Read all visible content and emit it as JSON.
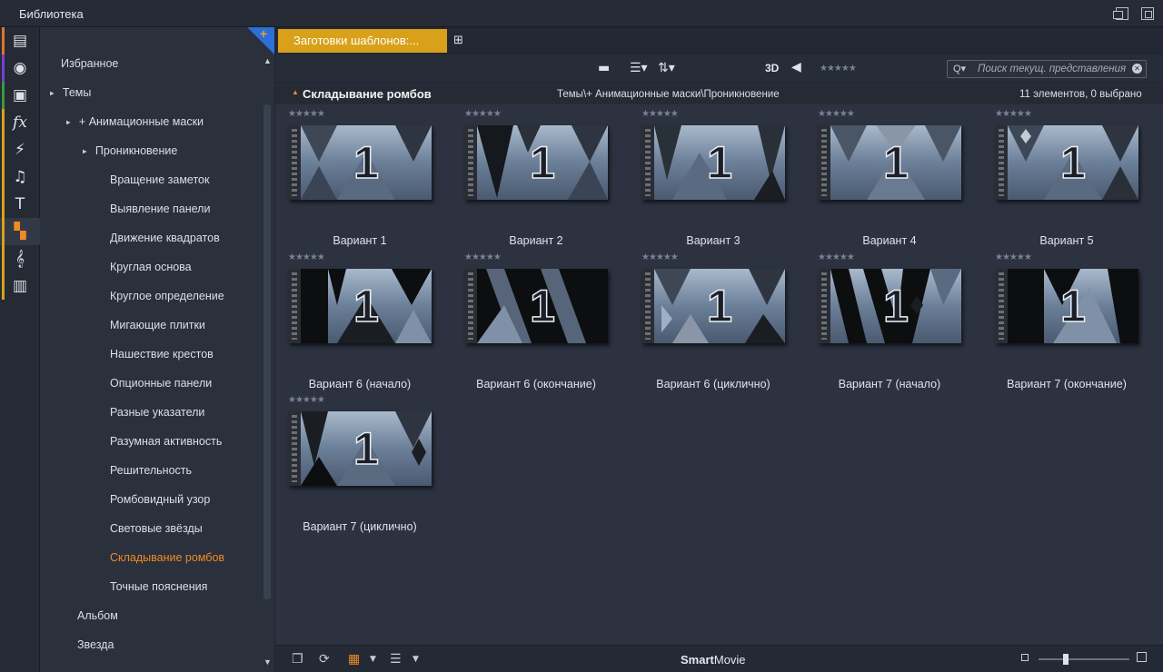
{
  "window": {
    "title": "Библиотека"
  },
  "sidebar_icons": [
    {
      "name": "projects-icon",
      "glyph": "▤",
      "color": "#e0762a"
    },
    {
      "name": "video-icon",
      "glyph": "◉",
      "color": "#7a3fd0"
    },
    {
      "name": "photo-icon",
      "glyph": "▣",
      "color": "#3a9c3a"
    },
    {
      "name": "fx-icon",
      "glyph": "fx",
      "color": "#d6a21a"
    },
    {
      "name": "transition-icon",
      "glyph": "⚡",
      "color": "#d6a21a"
    },
    {
      "name": "music-icon",
      "glyph": "♫",
      "color": "#d6a21a"
    },
    {
      "name": "title-icon",
      "glyph": "T",
      "color": "#d6a21a"
    },
    {
      "name": "montage-icon",
      "glyph": "▚",
      "color": "#d6a21a"
    },
    {
      "name": "scorefitter-icon",
      "glyph": "𝄞",
      "color": "#d6a21a"
    },
    {
      "name": "piano-icon",
      "glyph": "▥",
      "color": "#d6a21a"
    }
  ],
  "tree": {
    "items": [
      {
        "label": "Избранное",
        "indent": 0,
        "arrow": ""
      },
      {
        "label": "Темы",
        "indent": 0,
        "arrow": "▲"
      },
      {
        "label": "+ Анимационные маски",
        "indent": 1,
        "arrow": "▲"
      },
      {
        "label": "Проникновение",
        "indent": 2,
        "arrow": "▲"
      },
      {
        "label": "Вращение заметок",
        "indent": 3,
        "arrow": ""
      },
      {
        "label": "Выявление панели",
        "indent": 3,
        "arrow": ""
      },
      {
        "label": "Движение квадратов",
        "indent": 3,
        "arrow": ""
      },
      {
        "label": "Круглая основа",
        "indent": 3,
        "arrow": ""
      },
      {
        "label": "Круглое определение",
        "indent": 3,
        "arrow": ""
      },
      {
        "label": "Мигающие плитки",
        "indent": 3,
        "arrow": ""
      },
      {
        "label": "Нашествие крестов",
        "indent": 3,
        "arrow": ""
      },
      {
        "label": "Опционные панели",
        "indent": 3,
        "arrow": ""
      },
      {
        "label": "Разные указатели",
        "indent": 3,
        "arrow": ""
      },
      {
        "label": "Разумная активность",
        "indent": 3,
        "arrow": ""
      },
      {
        "label": "Решительность",
        "indent": 3,
        "arrow": ""
      },
      {
        "label": "Ромбовидный узор",
        "indent": 3,
        "arrow": ""
      },
      {
        "label": "Световые звёзды",
        "indent": 3,
        "arrow": ""
      },
      {
        "label": "Складывание ромбов",
        "indent": 3,
        "arrow": "",
        "selected": true
      },
      {
        "label": "Точные пояснения",
        "indent": 3,
        "arrow": ""
      },
      {
        "label": "Альбом",
        "indent": 1,
        "arrow": ""
      },
      {
        "label": "Звезда",
        "indent": 1,
        "arrow": ""
      }
    ]
  },
  "tabs": {
    "active_label": "Заготовки шаблонов:..."
  },
  "toolbar": {
    "three_d": "3D",
    "search_placeholder": "Поиск текущ. представления",
    "rating_stars": "★★★★★"
  },
  "pathbar": {
    "title": "Складывание ромбов",
    "path": "Темы\\+ Анимационные маски\\Проникновение",
    "count": "11 элементов, 0 выбрано"
  },
  "grid": {
    "stars": "★★★★★",
    "thumb_digit": "1",
    "items": [
      {
        "label": "Вариант 1",
        "variant": 1
      },
      {
        "label": "Вариант 2",
        "variant": 2
      },
      {
        "label": "Вариант 3",
        "variant": 3
      },
      {
        "label": "Вариант 4",
        "variant": 4
      },
      {
        "label": "Вариант 5",
        "variant": 5
      },
      {
        "label": "Вариант 6 (начало)",
        "variant": 6
      },
      {
        "label": "Вариант 6 (окончание)",
        "variant": 7
      },
      {
        "label": "Вариант 6 (циклично)",
        "variant": 8
      },
      {
        "label": "Вариант 7 (начало)",
        "variant": 9
      },
      {
        "label": "Вариант 7 (окончание)",
        "variant": 10
      },
      {
        "label": "Вариант 7 (циклично)",
        "variant": 11
      }
    ]
  },
  "bottombar": {
    "logo_bold": "Smart",
    "logo_rest": "Movie",
    "thumb_size_level": 0.3
  }
}
